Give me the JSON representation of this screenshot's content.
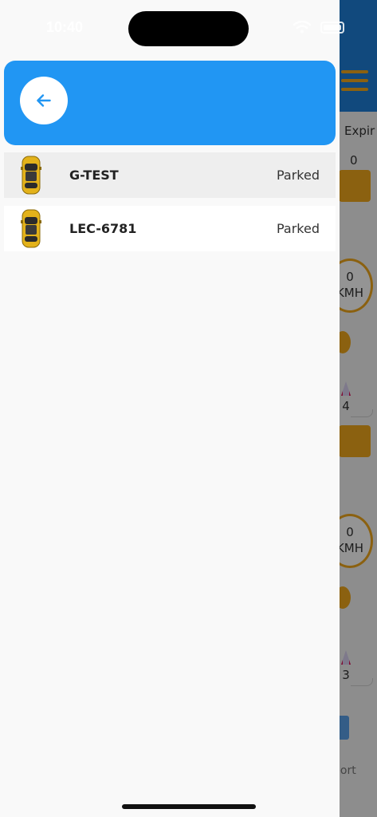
{
  "status_bar": {
    "time": "10:40"
  },
  "background_app": {
    "column_label": "Expir",
    "top_value": "0",
    "speed_unit": "KMH",
    "cards": [
      {
        "speed": "0",
        "signal": "4"
      },
      {
        "speed": "0",
        "signal": "3"
      }
    ],
    "report_label": "port",
    "colors": {
      "header": "#1e7fd8",
      "accent": "#f0a81c"
    }
  },
  "drawer": {
    "header_color": "#2196f3",
    "back_icon": "arrow-left-icon",
    "vehicles": [
      {
        "name": "G-TEST",
        "status": "Parked",
        "selected": true
      },
      {
        "name": "LEC-6781",
        "status": "Parked",
        "selected": false
      }
    ]
  }
}
